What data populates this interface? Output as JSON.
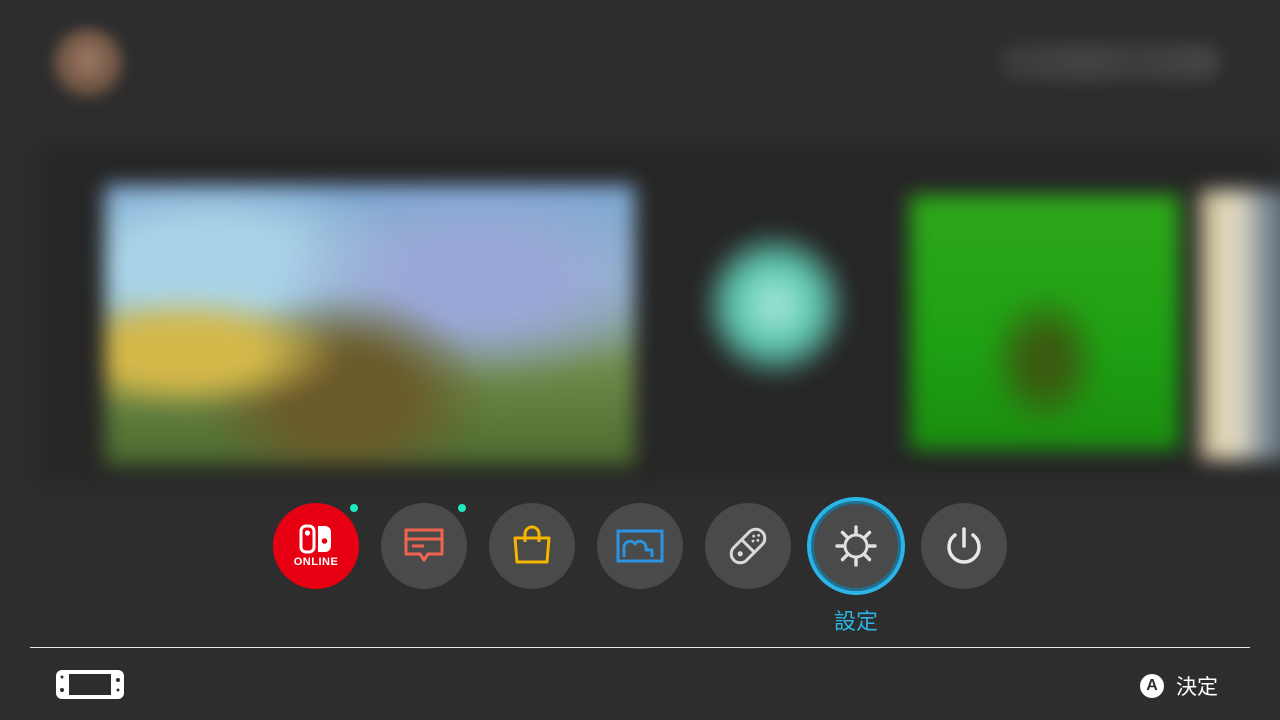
{
  "colors": {
    "background": "#2d2d2d",
    "accent": "#2bb4e6",
    "online_red": "#e60012",
    "notification": "#1ee8c0",
    "news_icon": "#f06450",
    "shop_icon": "#f7b500",
    "album_icon": "#2a93e2"
  },
  "top": {
    "user_avatar_icon": "user-avatar",
    "status_area": "blurred"
  },
  "games": [
    {
      "name": "game-tile-1"
    },
    {
      "name": "game-tile-2"
    },
    {
      "name": "game-tile-3"
    },
    {
      "name": "game-tile-4"
    }
  ],
  "menu": {
    "online_label": "ONLINE",
    "selected_label": "設定",
    "items": [
      {
        "icon": "nintendo-switch-online-icon",
        "notification": true
      },
      {
        "icon": "news-icon",
        "notification": true
      },
      {
        "icon": "shop-bag-icon",
        "notification": false
      },
      {
        "icon": "album-icon",
        "notification": false
      },
      {
        "icon": "controller-icon",
        "notification": false
      },
      {
        "icon": "gear-icon",
        "notification": false,
        "selected": true
      },
      {
        "icon": "power-icon",
        "notification": false
      }
    ]
  },
  "footer": {
    "console_icon": "handheld-console-icon",
    "a_button": "A",
    "confirm_label": "決定"
  }
}
